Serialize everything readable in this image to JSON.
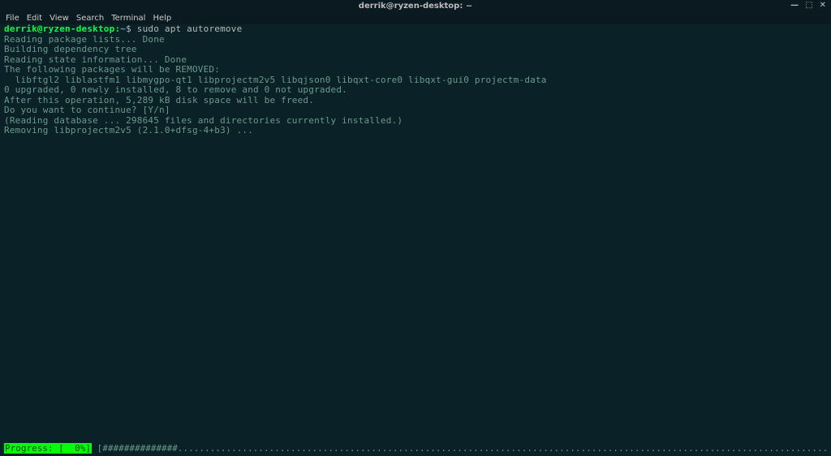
{
  "window": {
    "title": "derrik@ryzen-desktop: ~"
  },
  "menu": {
    "file": "File",
    "edit": "Edit",
    "view": "View",
    "search": "Search",
    "terminal": "Terminal",
    "help": "Help"
  },
  "controls": {
    "minimize": "—",
    "maximize": "⬚",
    "close": "✕"
  },
  "prompt": {
    "userhost": "derrik@ryzen-desktop:",
    "cwd": "~",
    "sigil": "$"
  },
  "command": "sudo apt autoremove",
  "output": {
    "l01": "Reading package lists... Done",
    "l02": "Building dependency tree",
    "l03": "Reading state information... Done",
    "l04": "The following packages will be REMOVED:",
    "l05": "  libftgl2 liblastfm1 libmygpo-qt1 libprojectm2v5 libqjson0 libqxt-core0 libqxt-gui0 projectm-data",
    "l06": "0 upgraded, 0 newly installed, 8 to remove and 0 not upgraded.",
    "l07": "After this operation, 5,289 kB disk space will be freed.",
    "l08": "Do you want to continue? [Y/n]",
    "l09": "(Reading database ... 298645 files and directories currently installed.)",
    "l10": "Removing libprojectm2v5 (2.1.0+dfsg-4+b3) ..."
  },
  "status": {
    "label": "Progress: [  0%]",
    "bar": " [##############..........................................................................................................................................................................................] "
  }
}
